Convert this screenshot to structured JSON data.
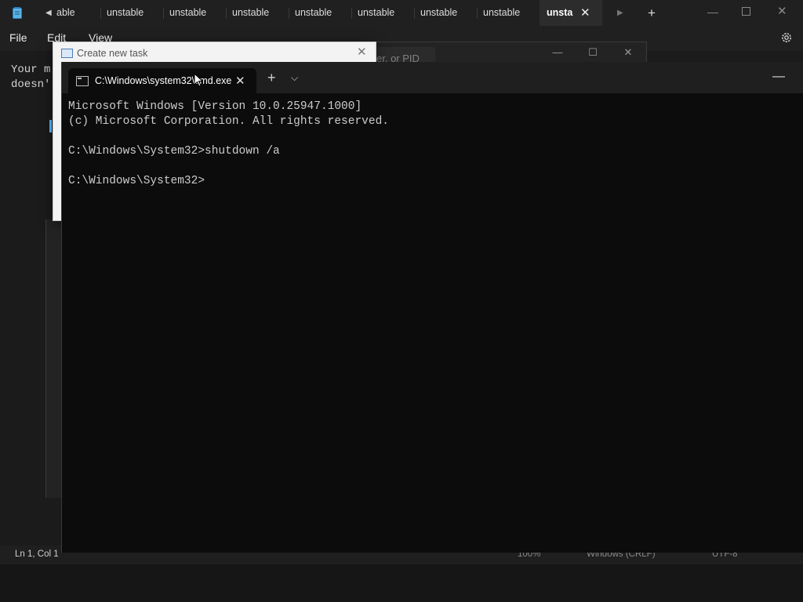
{
  "notepad": {
    "tabs": [
      "able",
      "unstable",
      "unstable",
      "unstable",
      "unstable",
      "unstable",
      "unstable",
      "unstable"
    ],
    "active_tab": "unsta",
    "menu": {
      "file": "File",
      "edit": "Edit",
      "view": "View"
    },
    "editor_lines": [
      "Your m",
      "doesn'"
    ],
    "status": {
      "position": "Ln 1, Col 1",
      "zoom": "100%",
      "line_ending": "Windows (CRLF)",
      "encoding": "UTF-8"
    }
  },
  "task_manager": {
    "search_hint": "er, or PID"
  },
  "run_dialog": {
    "title": "Create new task"
  },
  "terminal": {
    "tab_title": "C:\\Windows\\system32\\cmd.exe",
    "lines": [
      "Microsoft Windows [Version 10.0.25947.1000]",
      "(c) Microsoft Corporation. All rights reserved.",
      "",
      "C:\\Windows\\System32>shutdown /a",
      "",
      "C:\\Windows\\System32>"
    ]
  },
  "colors": {
    "terminal_bg": "#0c0c0c",
    "notepad_bg": "#1b1b1b",
    "accent": "#4aa0e0"
  }
}
